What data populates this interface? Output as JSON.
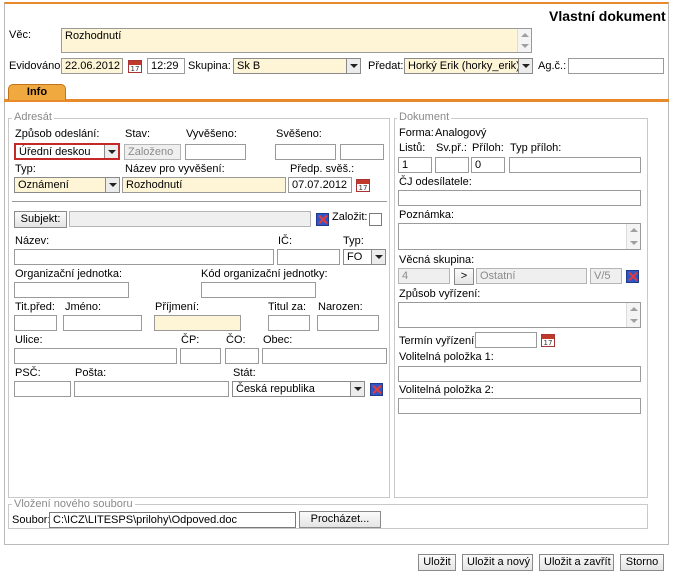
{
  "window": {
    "title": "Vlastní dokument"
  },
  "header": {
    "vec_label": "Věc:",
    "vec_value": "Rozhodnutí",
    "evidovano_label": "Evidováno:",
    "date_value": "22.06.2012",
    "time_value": "12:29",
    "skupina_label": "Skupina:",
    "skupina_value": "Sk B",
    "predat_label": "Předat:",
    "predat_value": "Horký Erik (horky_erik)",
    "agc_label": "Ag.č.:",
    "agc_value": ""
  },
  "tabs": [
    {
      "label": "Info"
    }
  ],
  "adresat": {
    "legend": "Adresát",
    "zpusob_label": "Způsob odeslání:",
    "zpusob_value": "Úřední deskou",
    "stav_label": "Stav:",
    "stav_value": "Založeno",
    "vyveseno_label": "Vyvěšeno:",
    "svereno_label": "Svěšeno:",
    "typ_label": "Typ:",
    "typ_value": "Oznámení",
    "nazev_vyveseni_label": "Název pro vyvěšení:",
    "nazev_vyveseni_value": "Rozhodnutí",
    "predp_label": "Předp. svěš.:",
    "predp_value": "07.07.2012",
    "subjekt_button": "Subjekt:",
    "zalozit_label": "Založit:",
    "nazev_label": "Název:",
    "ic_label": "IČ:",
    "typ2_label": "Typ:",
    "typ2_value": "FO",
    "org_label": "Organizační jednotka:",
    "kod_org_label": "Kód organizační jednotky:",
    "titpred_label": "Tit.před:",
    "jmeno_label": "Jméno:",
    "prijmeni_label": "Příjmení:",
    "titulza_label": "Titul za:",
    "narozen_label": "Narozen:",
    "ulice_label": "Ulice:",
    "cp_label": "ČP:",
    "co_label": "ČO:",
    "obec_label": "Obec:",
    "psc_label": "PSČ:",
    "posta_label": "Pošta:",
    "stat_label": "Stát:",
    "stat_value": "Česká republika"
  },
  "dokument": {
    "legend": "Dokument",
    "forma_label": "Forma:",
    "forma_value": "Analogový",
    "listu_label": "Listů:",
    "listu_value": "1",
    "svpr_label": "Sv.př.:",
    "svpr_value": "",
    "priloh_label": "Příloh:",
    "priloh_value": "0",
    "typ_priloh_label": "Typ příloh:",
    "cj_label": "ČJ odesílatele:",
    "poznamka_label": "Poznámka:",
    "vecna_label": "Věcná skupina:",
    "vecna_code": "4",
    "vecna_arrow": ">",
    "vecna_name": "Ostatní",
    "vecna_suffix": "V/5",
    "zpusob_vyrizeni_label": "Způsob vyřízení:",
    "termin_label": "Termín vyřízení:",
    "vol1_label": "Volitelná položka 1:",
    "vol2_label": "Volitelná položka 2:"
  },
  "soubor": {
    "legend": "Vložení nového souboru",
    "label": "Soubor:",
    "path": "C:\\ICZ\\LITESPS\\prilohy\\Odpoved.doc",
    "browse_button": "Procházet..."
  },
  "footer": {
    "ulozit": "Uložit",
    "ulozit_novy": "Uložit a nový",
    "ulozit_zavrit": "Uložit a zavřít",
    "storno": "Storno"
  },
  "colors": {
    "accent": "#e8892b",
    "tab": "#f0a93f",
    "required_bg": "#fdf5d6",
    "highlight_border": "#c62828"
  },
  "icons": {
    "calendar": "calendar-icon",
    "remove": "remove-x-icon"
  }
}
